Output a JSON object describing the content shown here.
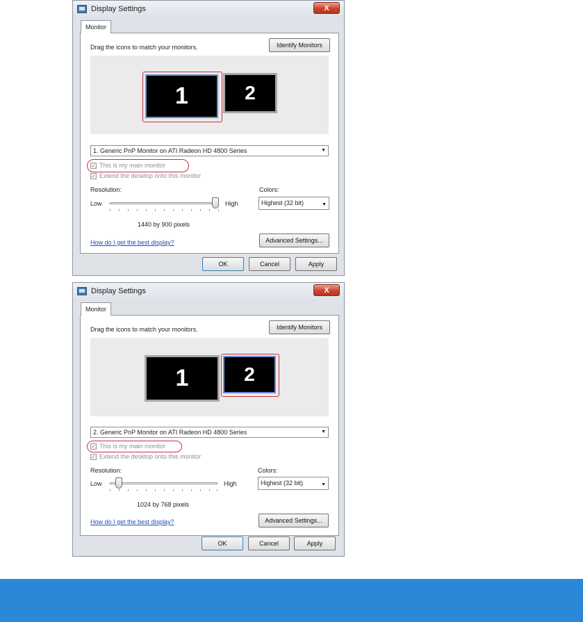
{
  "dialogs": [
    {
      "title": "Display Settings",
      "close_label": "X",
      "tab": "Monitor",
      "instruction": "Drag the icons to match your monitors.",
      "identify_label": "Identify Monitors",
      "monitors": [
        "1",
        "2"
      ],
      "selected_monitor": "1",
      "monitor_select": "1. Generic PnP Monitor on ATI Radeon HD 4800 Series",
      "main_monitor_label": "This is my main monitor",
      "main_monitor_checked": true,
      "extend_label": "Extend the desktop onto this monitor",
      "extend_checked": true,
      "resolution_label": "Resolution:",
      "low_label": "Low",
      "high_label": "High",
      "resolution_level": 1.0,
      "resolution_value": "1440 by 900 pixels",
      "colors_label": "Colors:",
      "colors_value": "Highest (32 bit)",
      "help_link": "How do I get the best display?",
      "advanced_label": "Advanced Settings...",
      "ok_label": "OK",
      "cancel_label": "Cancel",
      "apply_label": "Apply"
    },
    {
      "title": "Display Settings",
      "close_label": "X",
      "tab": "Monitor",
      "instruction": "Drag the icons to match your monitors.",
      "identify_label": "Identify Monitors",
      "monitors": [
        "1",
        "2"
      ],
      "selected_monitor": "2",
      "monitor_select": "2. Generic PnP Monitor on ATI Radeon HD 4800 Series",
      "main_monitor_label": "This is my main monitor",
      "main_monitor_checked": true,
      "extend_label": "Extend the desktop onto this monitor",
      "extend_checked": true,
      "resolution_label": "Resolution:",
      "low_label": "Low",
      "high_label": "High",
      "resolution_level": 0.0,
      "resolution_value": "1024 by 768 pixels",
      "colors_label": "Colors:",
      "colors_value": "Highest (32 bit)",
      "help_link": "How do I get the best display?",
      "advanced_label": "Advanced Settings...",
      "ok_label": "OK",
      "cancel_label": "Cancel",
      "apply_label": "Apply"
    }
  ],
  "colors": {
    "highlight": "#c83040",
    "link": "#1a4fb4",
    "footer": "#2b88d8",
    "monitor": "#000000"
  },
  "icons": [
    "display-settings-icon",
    "close-icon",
    "dropdown-arrow-icon",
    "checkmark-icon",
    "slider-thumb"
  ]
}
